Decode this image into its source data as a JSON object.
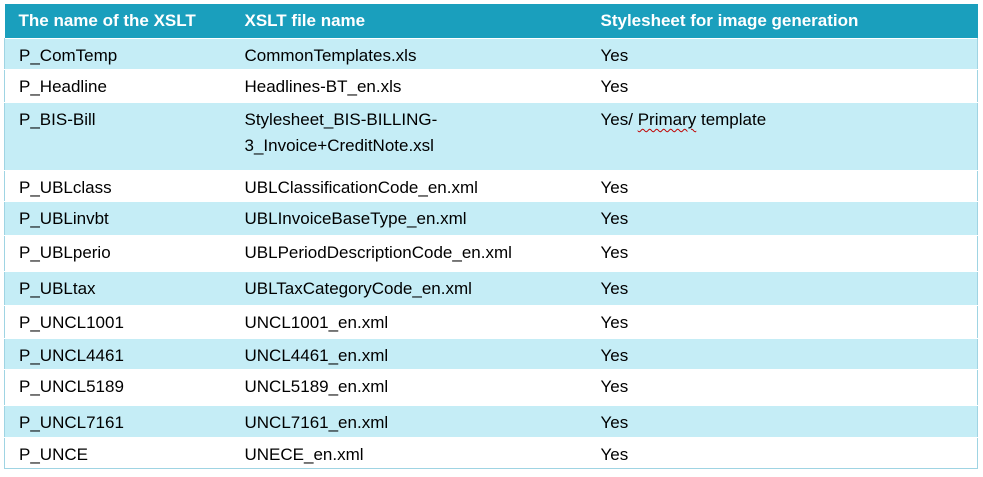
{
  "table": {
    "headers": [
      "The name of the XSLT",
      "XSLT file name",
      "Stylesheet for image generation"
    ],
    "rows": [
      {
        "name": "P_ComTemp",
        "file": "CommonTemplates.xls",
        "stylesheet": "Yes"
      },
      {
        "name": "P_Headline",
        "file": "Headlines-BT_en.xls",
        "stylesheet": "Yes"
      },
      {
        "name": "P_BIS-Bill",
        "file_line1": "Stylesheet_BIS-BILLING-",
        "file_line2": "3_Invoice+CreditNote.xsl",
        "stylesheet_prefix": "Yes/ ",
        "stylesheet_flagged": "Primary",
        "stylesheet_suffix": " template"
      },
      {
        "name": "P_UBLclass",
        "file": "UBLClassificationCode_en.xml",
        "stylesheet": "Yes"
      },
      {
        "name": "P_UBLinvbt",
        "file": "UBLInvoiceBaseType_en.xml",
        "stylesheet": "Yes"
      },
      {
        "name": "P_UBLperio",
        "file": "UBLPeriodDescriptionCode_en.xml",
        "stylesheet": "Yes"
      },
      {
        "name": "P_UBLtax",
        "file": "UBLTaxCategoryCode_en.xml",
        "stylesheet": "Yes"
      },
      {
        "name": "P_UNCL1001",
        "file": "UNCL1001_en.xml",
        "stylesheet": "Yes"
      },
      {
        "name": "P_UNCL4461",
        "file": "UNCL4461_en.xml",
        "stylesheet": "Yes"
      },
      {
        "name": "P_UNCL5189",
        "file": "UNCL5189_en.xml",
        "stylesheet": "Yes"
      },
      {
        "name": "P_UNCL7161",
        "file": "UNCL7161_en.xml",
        "stylesheet": "Yes"
      },
      {
        "name": "P_UNCE",
        "file": "UNECE_en.xml",
        "stylesheet": "Yes"
      }
    ]
  },
  "colors": {
    "header_background": "#1a9fbd",
    "header_text": "#ffffff",
    "band_fill": "#c5edf6",
    "plain_fill": "#ffffff",
    "spellcheck_underline": "#c00000"
  }
}
